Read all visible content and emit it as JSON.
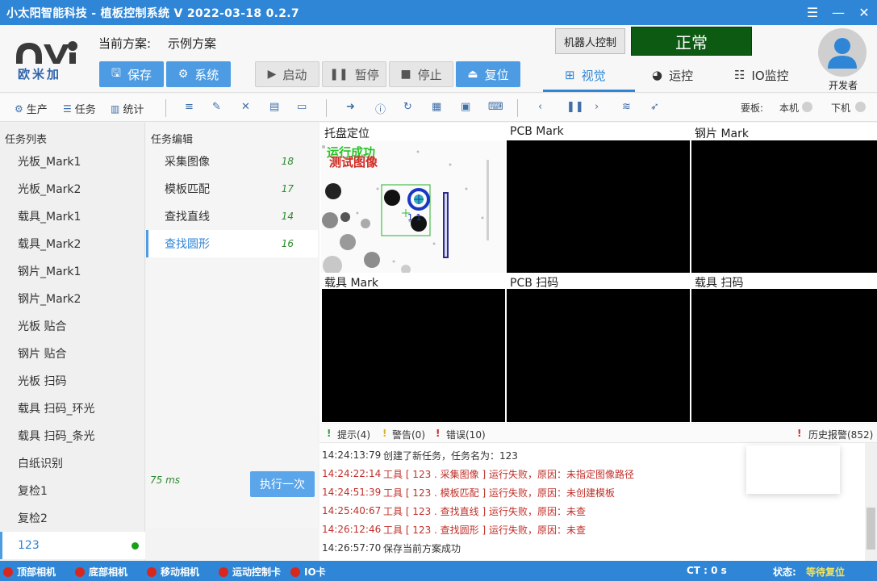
{
  "window": {
    "title": "小太阳智能科技 - 植板控制系统  V 2022-03-18 0.2.7"
  },
  "header": {
    "logo_text": "欧米加",
    "scheme_label": "当前方案:",
    "scheme_name": "示例方案",
    "buttons": {
      "save": "保存",
      "system": "系统",
      "start": "启动",
      "pause": "暂停",
      "stop": "停止",
      "reset": "复位"
    },
    "robot_control": "机器人控制",
    "status": "正常",
    "tabs": {
      "vision": "视觉",
      "motion": "运控",
      "io": "IO监控"
    },
    "user": "开发者",
    "colors": {
      "accent": "#2f86d6",
      "status_bg": "#0d5a13"
    }
  },
  "toolbar": {
    "production": "生产",
    "task": "任务",
    "stats": "统计",
    "board_label": "要板:",
    "local": "本机",
    "next": "下机"
  },
  "task_list": {
    "title": "任务列表",
    "items": [
      "光板_Mark1",
      "光板_Mark2",
      "载具_Mark1",
      "载具_Mark2",
      "钢片_Mark1",
      "钢片_Mark2",
      "光板 贴合",
      "钢片 贴合",
      "光板 扫码",
      "载具 扫码_环光",
      "载具 扫码_条光",
      "白纸识别",
      "复检1",
      "复检2",
      "123"
    ]
  },
  "task_edit": {
    "title": "任务编辑",
    "items": [
      {
        "name": "采集图像",
        "count": "18"
      },
      {
        "name": "模板匹配",
        "count": "17"
      },
      {
        "name": "查找直线",
        "count": "14"
      },
      {
        "name": "查找圆形",
        "count": "16"
      }
    ],
    "elapsed": "75 ms",
    "execute_once": "执行一次"
  },
  "cameras": {
    "tray": "托盘定位",
    "pcb_mark": "PCB Mark",
    "steel_mark": "钢片 Mark",
    "carrier_mark": "载具 Mark",
    "pcb_scan": "PCB 扫码",
    "carrier_scan": "载具 扫码",
    "overlay_run_ok": "运行成功",
    "overlay_test_image": "测试图像",
    "overlay_mark": "1 1"
  },
  "log": {
    "hint": "提示(4)",
    "warn": "警告(0)",
    "error": "错误(10)",
    "history": "历史报警(852)",
    "rows": [
      {
        "time": "14:24:13:79",
        "msg": "创建了新任务，任务名为：123"
      },
      {
        "time": "14:24:22:14",
        "msg": "工具 [ 123 . 采集图像 ] 运行失败，原因：未指定图像路径"
      },
      {
        "time": "14:24:51:39",
        "msg": "工具 [ 123 . 模板匹配 ] 运行失败，原因：未创建模板"
      },
      {
        "time": "14:25:40:67",
        "msg": "工具 [ 123 . 查找直线 ] 运行失败，原因：未查"
      },
      {
        "time": "14:26:12:46",
        "msg": "工具 [ 123 . 查找圆形 ] 运行失败，原因：未查"
      },
      {
        "time": "14:26:57:70",
        "msg": "保存当前方案成功"
      }
    ]
  },
  "statusbar": {
    "top_cam": "顶部相机",
    "bottom_cam": "底部相机",
    "move_cam": "移动相机",
    "motion_card": "运动控制卡",
    "io_card": "IO卡",
    "ct": "CT :  0 s",
    "state_label": "状态:",
    "state_value": "等待复位"
  }
}
